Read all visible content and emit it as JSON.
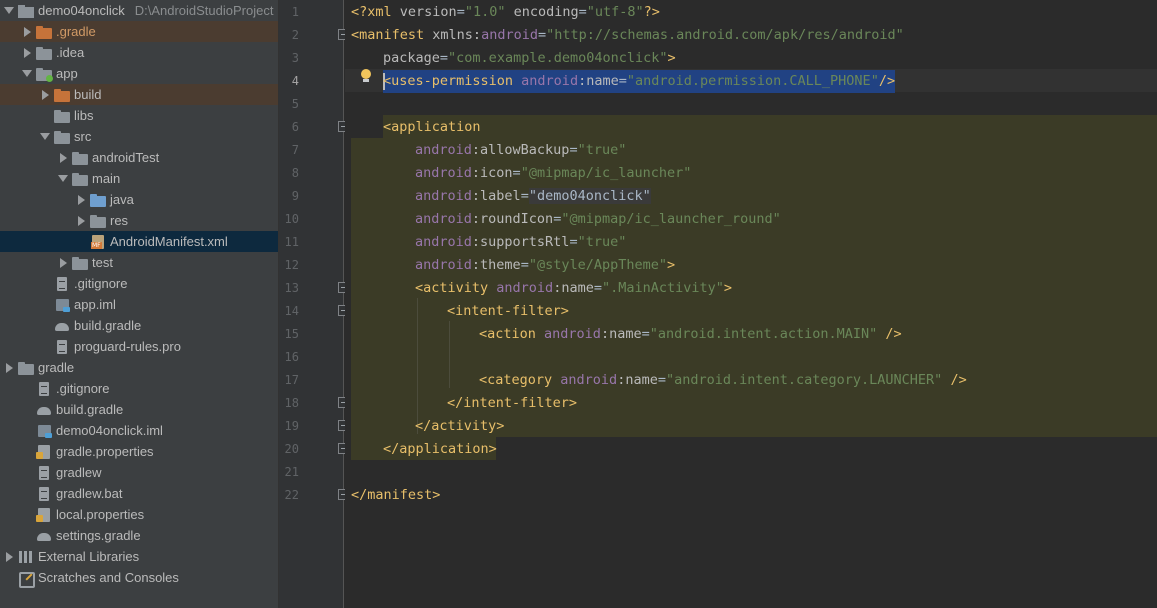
{
  "project_tree": {
    "root": {
      "label": "demo04onclick",
      "path": "D:\\AndroidStudioProject"
    },
    "items": [
      {
        "label": ".gradle"
      },
      {
        "label": ".idea"
      },
      {
        "label": "app"
      },
      {
        "label": "build"
      },
      {
        "label": "libs"
      },
      {
        "label": "src"
      },
      {
        "label": "androidTest"
      },
      {
        "label": "main"
      },
      {
        "label": "java"
      },
      {
        "label": "res"
      },
      {
        "label": "AndroidManifest.xml"
      },
      {
        "label": "test"
      },
      {
        "label": ".gitignore"
      },
      {
        "label": "app.iml"
      },
      {
        "label": "build.gradle"
      },
      {
        "label": "proguard-rules.pro"
      },
      {
        "label": "gradle"
      },
      {
        "label": ".gitignore"
      },
      {
        "label": "build.gradle"
      },
      {
        "label": "demo04onclick.iml"
      },
      {
        "label": "gradle.properties"
      },
      {
        "label": "gradlew"
      },
      {
        "label": "gradlew.bat"
      },
      {
        "label": "local.properties"
      },
      {
        "label": "settings.gradle"
      },
      {
        "label": "External Libraries"
      },
      {
        "label": "Scratches and Consoles"
      }
    ]
  },
  "editor": {
    "current_line": "4",
    "line_numbers": [
      "1",
      "2",
      "3",
      "4",
      "5",
      "6",
      "7",
      "8",
      "9",
      "10",
      "11",
      "12",
      "13",
      "14",
      "15",
      "16",
      "17",
      "18",
      "19",
      "20",
      "21",
      "22"
    ],
    "tokens": {
      "l1_a": "<?xml ",
      "l1_b": "version",
      "l1_c": "=",
      "l1_d": "\"1.0\"",
      "l1_e": " encoding",
      "l1_f": "=",
      "l1_g": "\"utf-8\"",
      "l1_h": "?>",
      "l2_a": "<manifest ",
      "l2_b": "xmlns:",
      "l2_c": "android",
      "l2_d": "=",
      "l2_e": "\"http://schemas.android.com/apk/res/android\"",
      "l3_a": "package",
      "l3_b": "=",
      "l3_c": "\"com.example.demo04onclick\"",
      "l3_d": ">",
      "l4_a": "<uses-permission ",
      "l4_b": "android",
      "l4_c": ":name",
      "l4_d": "=",
      "l4_e": "\"android.permission.CALL_PHONE\"",
      "l4_f": "/>",
      "l6_a": "<application",
      "l7_a": "android",
      "l7_b": ":allowBackup",
      "l7_c": "=",
      "l7_d": "\"true\"",
      "l8_a": "android",
      "l8_b": ":icon",
      "l8_c": "=",
      "l8_d": "\"@mipmap/ic_launcher\"",
      "l9_a": "android",
      "l9_b": ":label",
      "l9_c": "=",
      "l9_d": "\"demo04onclick\"",
      "l10_a": "android",
      "l10_b": ":roundIcon",
      "l10_c": "=",
      "l10_d": "\"@mipmap/ic_launcher_round\"",
      "l11_a": "android",
      "l11_b": ":supportsRtl",
      "l11_c": "=",
      "l11_d": "\"true\"",
      "l12_a": "android",
      "l12_b": ":theme",
      "l12_c": "=",
      "l12_d": "\"@style/AppTheme\"",
      "l12_e": ">",
      "l13_a": "<activity ",
      "l13_b": "android",
      "l13_c": ":name",
      "l13_d": "=",
      "l13_e": "\".MainActivity\"",
      "l13_f": ">",
      "l14_a": "<intent-filter>",
      "l15_a": "<action ",
      "l15_b": "android",
      "l15_c": ":name",
      "l15_d": "=",
      "l15_e": "\"android.intent.action.MAIN\"",
      "l15_f": " />",
      "l17_a": "<category ",
      "l17_b": "android",
      "l17_c": ":name",
      "l17_d": "=",
      "l17_e": "\"android.intent.category.LAUNCHER\"",
      "l17_f": " />",
      "l18_a": "</intent-filter>",
      "l19_a": "</activity>",
      "l20_a": "</application>",
      "l22_a": "</manifest>"
    }
  },
  "colors": {
    "tag": "#e8bf6a",
    "attribute": "#bababa",
    "namespace": "#9876aa",
    "value": "#6a8759",
    "selection": "#214283",
    "scope_highlight": "#3b3b26",
    "tree_selected": "#0d293e",
    "tree_excluded": "#4b3c30"
  }
}
